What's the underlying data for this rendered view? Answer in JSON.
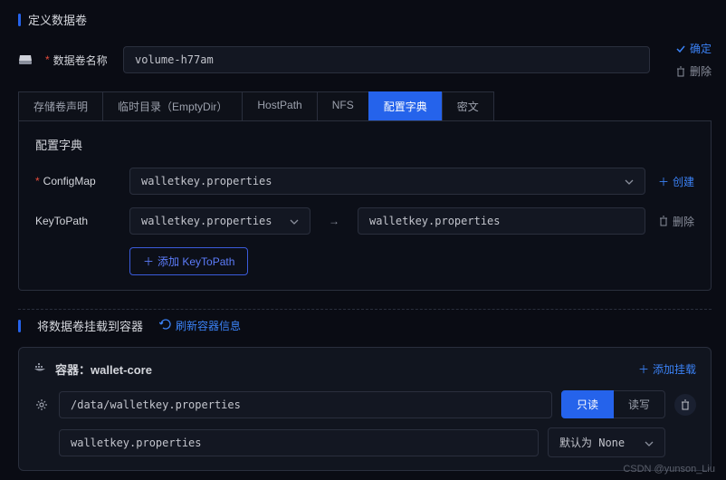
{
  "section1": {
    "title": "定义数据卷",
    "nameLabel": "数据卷名称",
    "nameValue": "volume-h77am",
    "confirm": "确定",
    "delete": "删除"
  },
  "tabs": [
    "存储卷声明",
    "临时目录（EmptyDir）",
    "HostPath",
    "NFS",
    "配置字典",
    "密文"
  ],
  "activeTab": 4,
  "configmap": {
    "panelTitle": "配置字典",
    "cmLabel": "ConfigMap",
    "cmValue": "walletkey.properties",
    "create": "创建",
    "ktpLabel": "KeyToPath",
    "ktpKey": "walletkey.properties",
    "ktpPath": "walletkey.properties",
    "delete": "删除",
    "addKtp": "添加 KeyToPath"
  },
  "section2": {
    "title": "将数据卷挂载到容器",
    "refresh": "刷新容器信息"
  },
  "container": {
    "prefix": "容器：",
    "name": "wallet-core",
    "addMount": "添加挂载",
    "mountPath": "/data/walletkey.properties",
    "readOnly": "只读",
    "readWrite": "读写",
    "subPath": "walletkey.properties",
    "modeDefault": "默认为 None"
  },
  "watermark": "CSDN @yunson_Liu"
}
